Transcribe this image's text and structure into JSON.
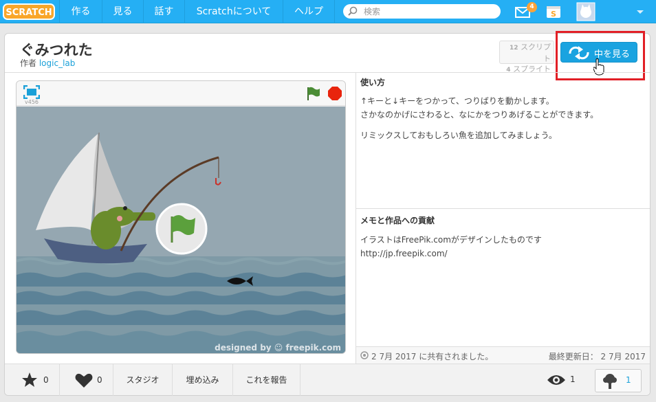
{
  "brand": {
    "logo_text": "SCRATCH",
    "accent": "#25aff4",
    "highlight": "#e21f26"
  },
  "nav": {
    "items": [
      {
        "label": "作る"
      },
      {
        "label": "見る"
      },
      {
        "label": "話す"
      },
      {
        "label": "Scratchについて"
      },
      {
        "label": "ヘルプ"
      }
    ],
    "search_placeholder": "検索",
    "message_count": "4",
    "icons": [
      "search-icon",
      "messages-icon",
      "mystuff-icon",
      "avatar",
      "chevron-down-icon"
    ]
  },
  "project": {
    "title": "ぐみつれた",
    "author_prefix": "作者",
    "author": "logic_lab",
    "scripts_count": "12",
    "scripts_label": "スクリプト",
    "sprites_count": "4",
    "sprites_label": "スプライト",
    "see_inside": "中を見る",
    "version": "v456",
    "watermark": "designed by ☺ freepik.com"
  },
  "instructions": {
    "title": "使い方",
    "line1": "↑キーと↓キーをつかって、つりばりを動かします。",
    "line2": "さかなのかげにさわると、なにかをつりあげることができます。",
    "line3": "リミックスしておもしろい魚を追加してみましょう。"
  },
  "notes": {
    "title": "メモと作品への貢献",
    "line1": "イラストはFreePik.comがデザインしたものです",
    "line2": "http://jp.freepik.com/"
  },
  "meta": {
    "shared": "2 7月 2017 に共有されました。",
    "updated": "最終更新日： 2 7月 2017"
  },
  "actions": {
    "favorites": "0",
    "loves": "0",
    "studio": "スタジオ",
    "embed": "埋め込み",
    "report": "これを報告",
    "views": "1",
    "remixes": "1"
  }
}
